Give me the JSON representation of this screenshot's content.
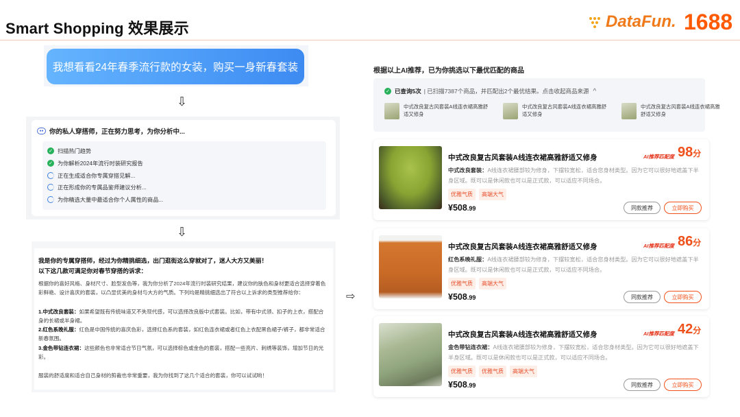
{
  "header": {
    "title": "Smart Shopping 效果展示",
    "logo_datafun": "DataFun.",
    "logo_1688": "1688"
  },
  "left": {
    "query": "我想看看24年春季流行款的女装，购买一身新春套装",
    "think_title": "你的私人穿搭师，正在努力思考，为你分析中...",
    "steps": [
      {
        "label": "扫描热门趋势",
        "status": "done"
      },
      {
        "label": "为你解析2024年流行时装研究报告",
        "status": "done"
      },
      {
        "label": "正在生成适合你专属穿搭见解...",
        "status": "loading"
      },
      {
        "label": "正在形成你的专属品鉴师建议分析...",
        "status": "loading"
      },
      {
        "label": "为你精选大量中最适合你个人属性的商品...",
        "status": "loading"
      }
    ],
    "result_head_1": "我是你的专属穿搭师，经过为你精挑细选，出门逛街这么穿就对了，迷人大方又美丽！",
    "result_head_2": "以下这几款可满足你对春节穿搭的诉求：",
    "intro": "根据你的喜好风格、身材尺寸、脸型发色等，我为你分析了2024年流行时装研究结果，建议你的肤色和身材更适合选择穿着色彩鲜艳、设计喜庆的套装，以凸显优美的身材与大方的气质。下列均是精挑细选出了符合以上诉求的类型推荐给你：",
    "items": [
      {
        "name": "1.中式改良套装：",
        "text": "如果希望既有传统味道又不失现代感，可以选择改良版中式套装。比如，带有中式领、扣子的上衣，搭配合身的长裙或半身裙。"
      },
      {
        "name": "2.红色系晚礼服：",
        "text": "红色是中国传统的喜庆色彩，选择红色系的套装，如红色连衣裙或者红色上衣配黑色裙子/裤子，都非常适合新春氛围。"
      },
      {
        "name": "3.金色带钻连衣裙：",
        "text": "这些颜色也非常适合节日气氛，可以选择棕色或金色的套装，搭配一些亮片、刺绣等装饰，增加节日的光彩。"
      }
    ],
    "outro": "服装的舒适度和适合自己身材的剪裁也非常重要，我为你找到了这几个适合的套装，你可以试试哟！"
  },
  "right": {
    "head": "根据以上AI推荐，已为你挑选以下最优匹配的商品",
    "query_status_bold": "已查询5次",
    "query_status_rest": "| 已扫描7387个商品，并匹配出2个最优结果。点击收起商品来源",
    "query_toggle": "^",
    "mini_items": [
      "中式改良复古风套装A线连衣裙高雅舒适又修身",
      "中式改良复古风套装A线连衣裙高雅舒适又修身",
      "中式改良复古风套装A线连衣裙高雅舒适又修身"
    ],
    "ai_label": "AI推荐匹配度",
    "products": [
      {
        "title": "中式改良复古风套装A线连衣裙高雅舒适又修身",
        "score": "98",
        "score_unit": "分",
        "desc_name": "中式改良套装：",
        "desc": "A线连衣裙腰部较为修身，下摆较宽松，适合您身材类型。因为它可以很好地遮盖下半身区域。既可以是休闲款也可以是正式款，可以适应不同场合。",
        "tags": [
          "优雅气质",
          "高端大气"
        ],
        "price_int": "¥508",
        "price_dec": ".99",
        "btn_similar": "同款推荐",
        "btn_buy": "立即购买"
      },
      {
        "title": "中式改良复古风套装A线连衣裙高雅舒适又修身",
        "score": "86",
        "score_unit": "分",
        "desc_name": "红色系晚礼服：",
        "desc": "A线连衣裙腰部较为修身，下摆较宽松，适合您身材类型。因为它可以很好地遮盖下半身区域。既可以是休闲款也可以是正式款，可以适应不同场合。",
        "tags": [
          "优雅气质",
          "高端大气"
        ],
        "price_int": "¥508",
        "price_dec": ".99",
        "btn_similar": "同款推荐",
        "btn_buy": "立即购买"
      },
      {
        "title": "中式改良复古风套装A线连衣裙高雅舒适又修身",
        "score": "42",
        "score_unit": "分",
        "desc_name": "金色带钻连衣裙：",
        "desc": "A线连衣裙腰部较为修身，下摆较宽松，适合您身材类型。因为它可以很好地遮盖下半身区域。既可以是休闲款也可以是正式款，可以适应不同场合。",
        "tags": [
          "优雅气质",
          "优雅气质",
          "高端大气"
        ],
        "price_int": "¥508",
        "price_dec": ".99",
        "btn_similar": "同款推荐",
        "btn_buy": "立即购买"
      }
    ]
  },
  "colors": {
    "accent": "#f0501a",
    "brand_1688": "#ff5a00",
    "query_bubble": "#3d8bf2",
    "done_green": "#27b15a"
  },
  "icons": {
    "down_arrow": "⇩",
    "right_arrow": "⇨"
  }
}
